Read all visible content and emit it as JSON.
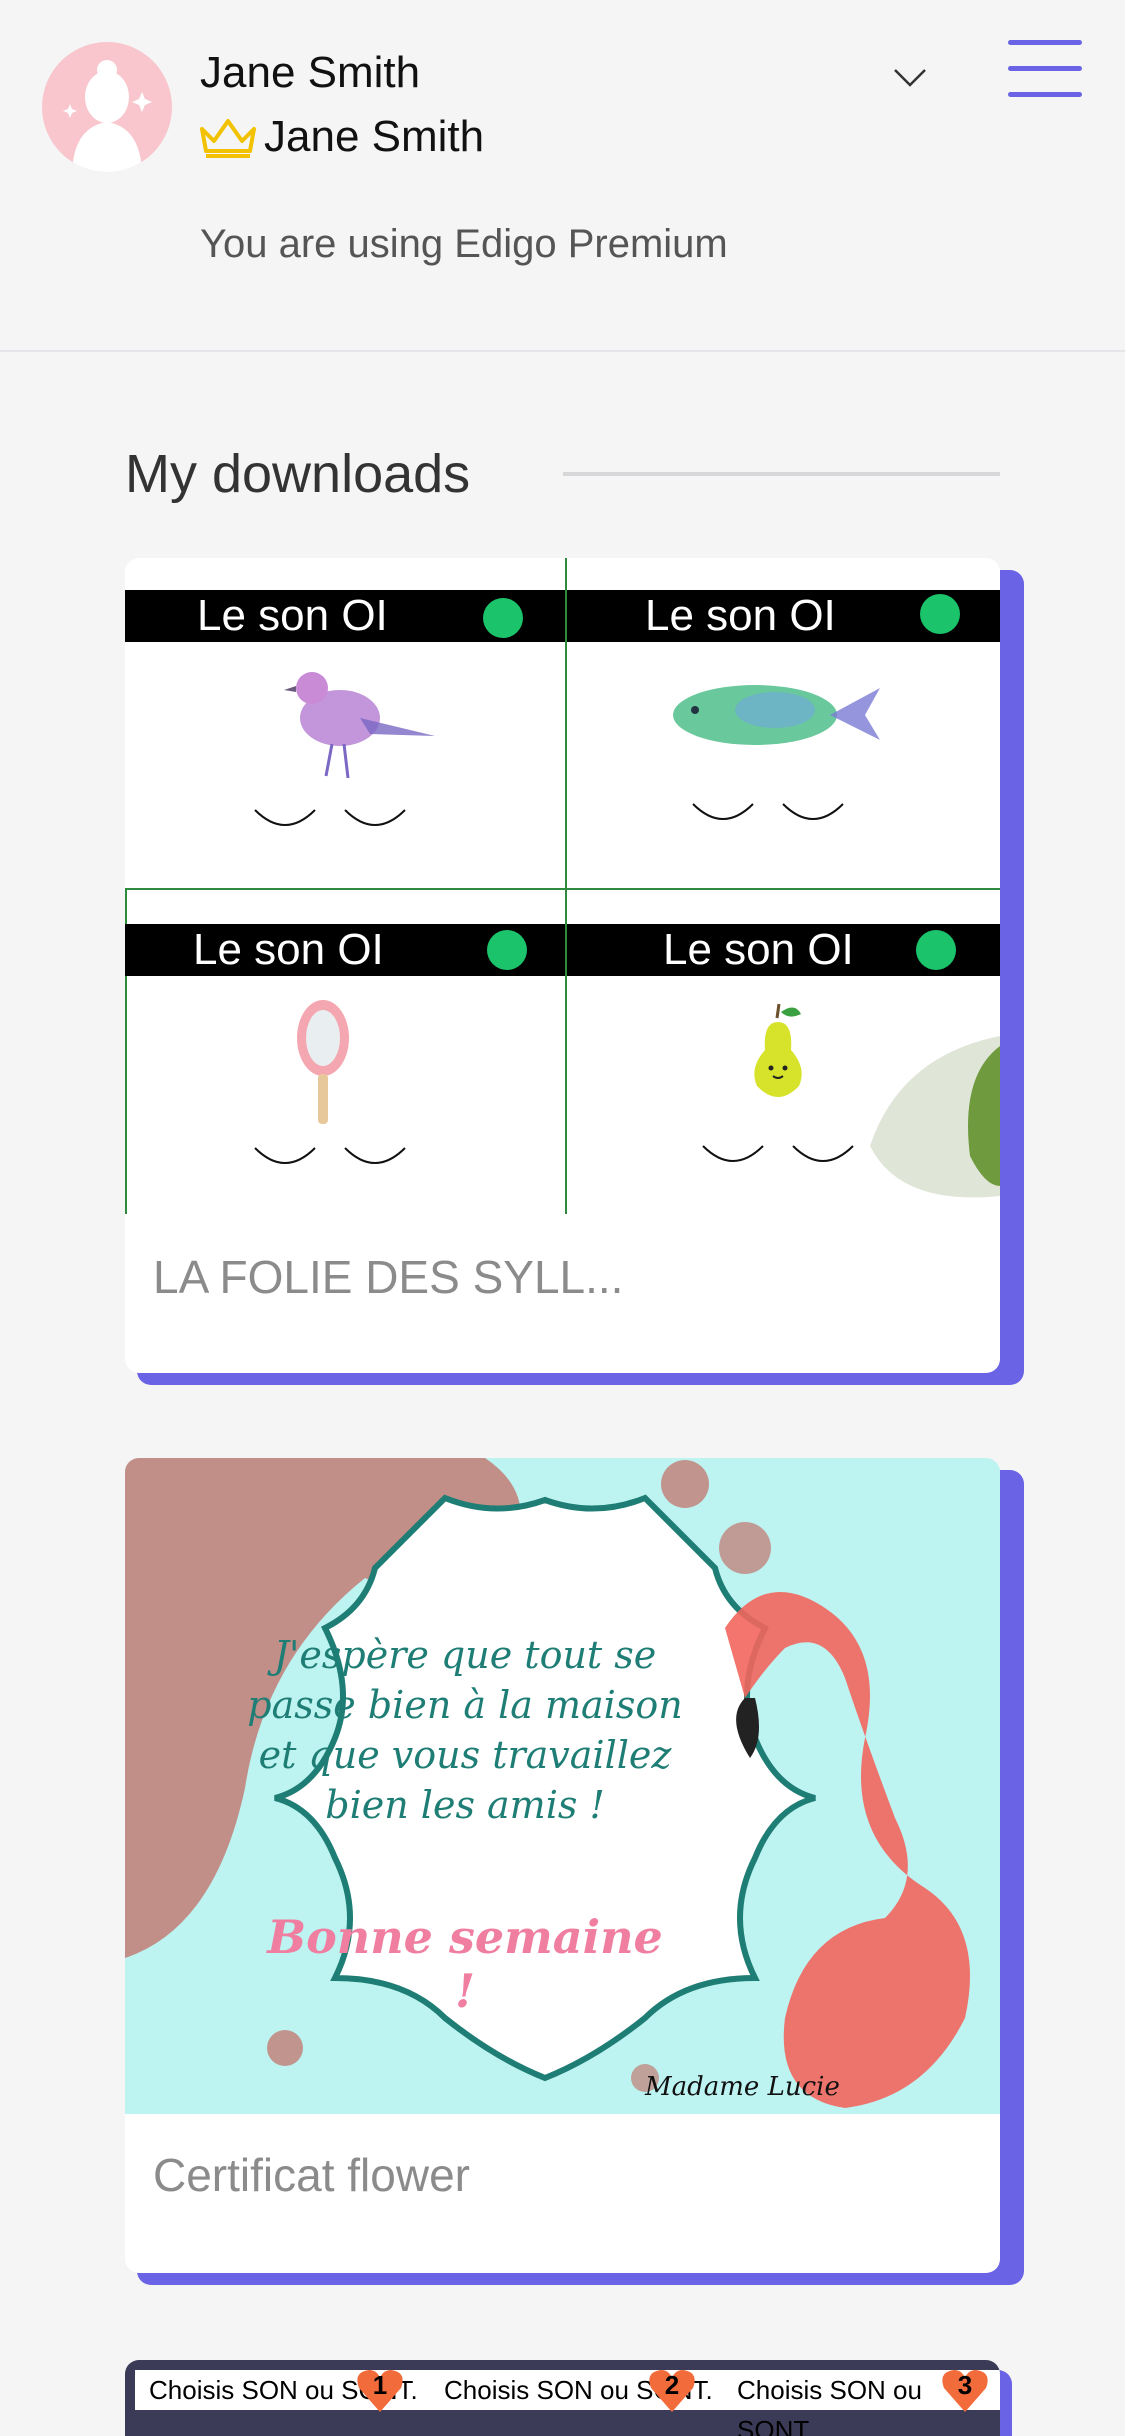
{
  "header": {
    "user_name": "Jane Smith",
    "plan_user_name": "Jane Smith",
    "premium_text": "You are using Edigo Premium"
  },
  "section": {
    "title": "My downloads"
  },
  "downloads": [
    {
      "title": "LA FOLIE DES SYLL...",
      "thumb_cells": [
        "Le son OI",
        "Le son OI",
        "Le son OI",
        "Le son OI"
      ]
    },
    {
      "title": "Certificat flower",
      "thumb_text": {
        "line1": "J'espère que tout se",
        "line2": "passe bien à la maison",
        "line3": "et que vous travaillez",
        "line4": "bien les amis !",
        "headline": "Bonne semaine !",
        "signature": "Madame Lucie"
      }
    }
  ],
  "peek_card": {
    "labels": [
      "Choisis SON ou SONT.",
      "Choisis SON ou SONT.",
      "Choisis SON ou SONT."
    ],
    "numbers": [
      "1",
      "2",
      "3"
    ]
  },
  "colors": {
    "accent": "#6b63e6",
    "green_dot": "#1bc46b",
    "grid_line": "#2e8b3d",
    "teal_text": "#1e7d74",
    "pink_text": "#f07ea0"
  },
  "icons": {
    "avatar": "avatar-icon",
    "crown": "crown-icon",
    "chevron": "chevron-down-icon",
    "menu": "hamburger-menu-icon"
  }
}
